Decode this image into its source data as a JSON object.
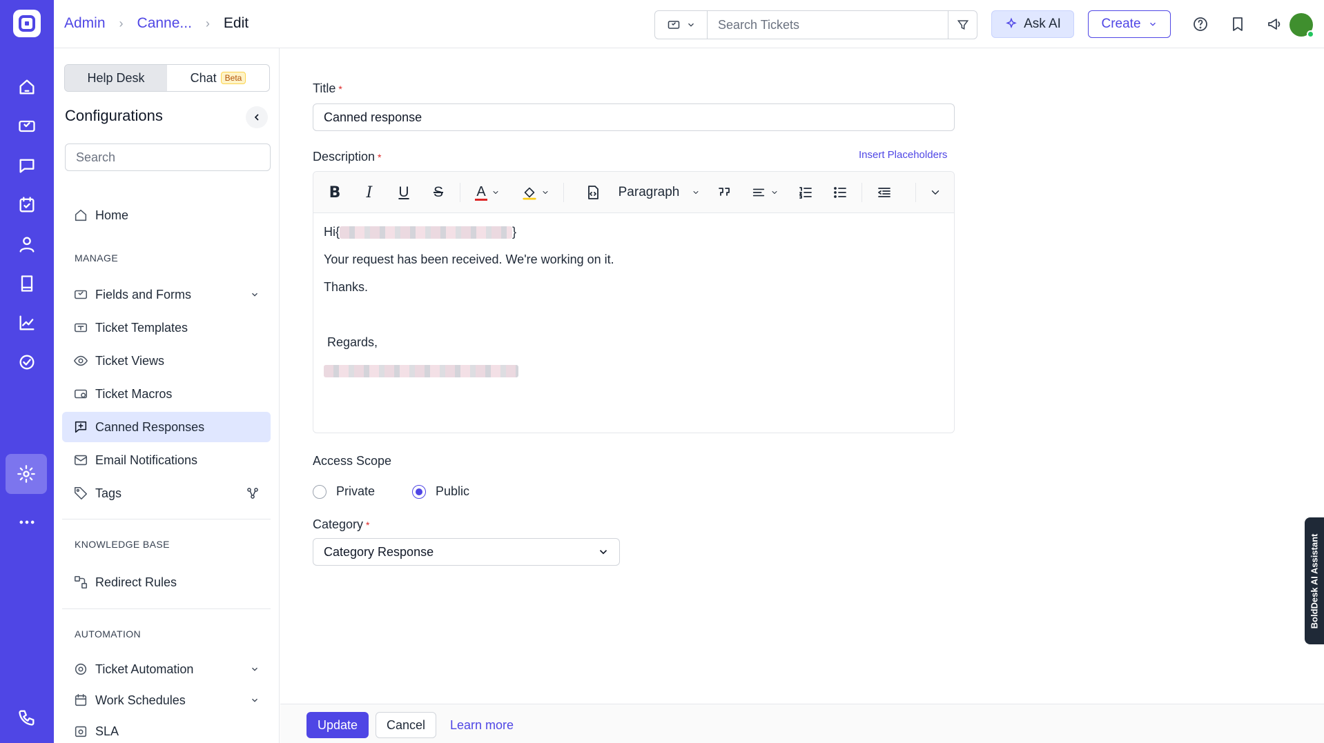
{
  "breadcrumb": {
    "admin": "Admin",
    "section": "Canne...",
    "current": "Edit"
  },
  "topbar": {
    "search_placeholder": "Search Tickets",
    "ask_ai": "Ask AI",
    "create": "Create"
  },
  "sidebar": {
    "tabs": {
      "helpdesk": "Help Desk",
      "chat": "Chat",
      "beta": "Beta"
    },
    "title": "Configurations",
    "search_placeholder": "Search",
    "home": "Home",
    "manage_header": "MANAGE",
    "manage_items": {
      "fields_forms": "Fields and Forms",
      "ticket_templates": "Ticket Templates",
      "ticket_views": "Ticket Views",
      "ticket_macros": "Ticket Macros",
      "canned_responses": "Canned Responses",
      "email_notifications": "Email Notifications",
      "tags": "Tags"
    },
    "kb_header": "KNOWLEDGE BASE",
    "redirect_rules": "Redirect Rules",
    "automation_header": "AUTOMATION",
    "ticket_automation": "Ticket Automation",
    "work_schedules": "Work Schedules",
    "sla": "SLA"
  },
  "form": {
    "title_label": "Title",
    "title_value": "Canned response",
    "description_label": "Description",
    "insert_placeholders": "Insert Placeholders",
    "paragraph": "Paragraph",
    "body": {
      "greeting": "Hi{",
      "greeting_close": "}",
      "line1": "Your request has been received. We're working on it.",
      "line2": "Thanks.",
      "regards": "Regards,"
    },
    "access_scope_label": "Access Scope",
    "private": "Private",
    "public": "Public",
    "category_label": "Category",
    "category_value": "Category Response"
  },
  "footer": {
    "update": "Update",
    "cancel": "Cancel",
    "learn_more": "Learn more"
  },
  "ai_assistant_tab": "BoldDesk AI Assistant",
  "colors": {
    "brand": "#4f46e5",
    "active_bg": "#e0e7ff"
  }
}
